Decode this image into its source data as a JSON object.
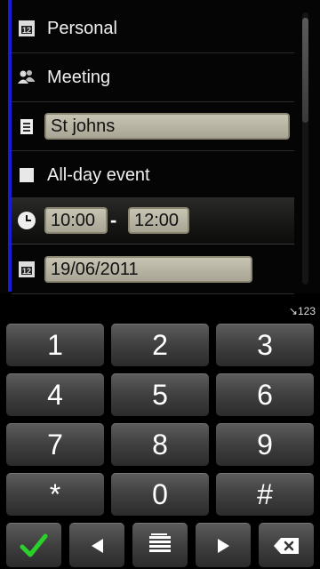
{
  "form": {
    "calendar_label": "Personal",
    "entry_type_label": "Meeting",
    "location_value": "St johns",
    "allday_label": "All-day event",
    "start_time": "10:00",
    "time_separator": "-",
    "end_time": "12:00",
    "date_value": "19/06/2011",
    "calendar_icon_text": "12",
    "date_icon_text": "12"
  },
  "keypad": {
    "mode_indicator": "↘123",
    "keys": [
      "1",
      "2",
      "3",
      "4",
      "5",
      "6",
      "7",
      "8",
      "9",
      "*",
      "0",
      "#"
    ]
  },
  "icons": {
    "confirm": "check-icon",
    "left": "arrow-left-icon",
    "menu": "menu-icon",
    "right": "arrow-right-icon",
    "backspace": "backspace-icon"
  },
  "colors": {
    "accent": "#1a1bd6",
    "confirm": "#2bd12b"
  }
}
